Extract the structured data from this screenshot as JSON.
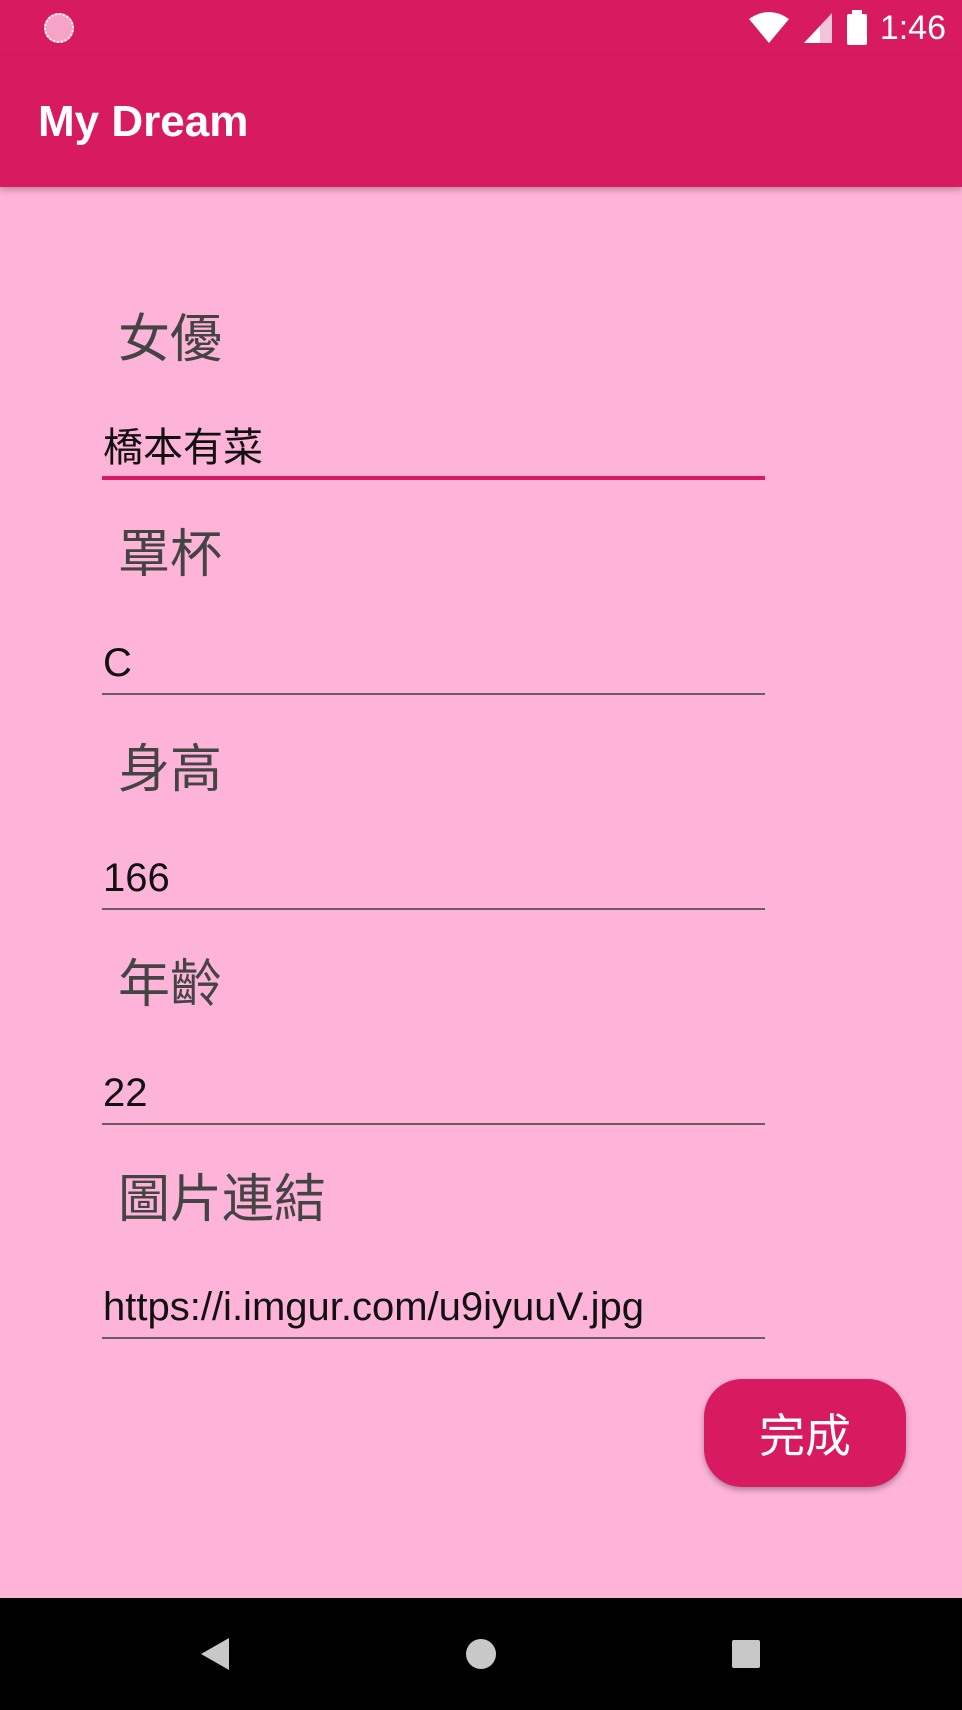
{
  "status_bar": {
    "time": "1:46"
  },
  "app_bar": {
    "title": "My Dream"
  },
  "form": {
    "actress_label": "女優",
    "actress_value": "橋本有菜",
    "cup_label": "罩杯",
    "cup_value": "C",
    "height_label": "身高",
    "height_value": "166",
    "age_label": "年齡",
    "age_value": "22",
    "image_link_label": "圖片連結",
    "image_link_value": "https://i.imgur.com/u9iyuuV.jpg"
  },
  "done_button": {
    "label": "完成"
  },
  "colors": {
    "primary": "#D81B60",
    "background": "#FEB3D9"
  },
  "icons": [
    "notification-icon",
    "wifi-icon",
    "cell-signal-icon",
    "battery-icon",
    "back-icon",
    "home-icon",
    "recents-icon"
  ]
}
